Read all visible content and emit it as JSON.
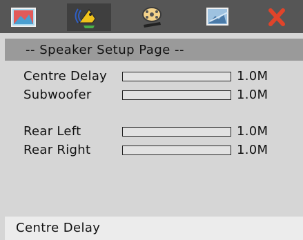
{
  "menu": {
    "tabs": [
      {
        "icon": "picture-icon",
        "active": false
      },
      {
        "icon": "speaker-icon",
        "active": true
      },
      {
        "icon": "film-reel-icon",
        "active": false
      },
      {
        "icon": "image-icon",
        "active": false
      },
      {
        "icon": "close-x-icon",
        "active": false
      }
    ]
  },
  "header": {
    "title": "-- Speaker Setup Page --"
  },
  "rows": [
    {
      "label": "Centre Delay",
      "value": "1.0M"
    },
    {
      "label": "Subwoofer",
      "value": "1.0M"
    },
    {
      "label": "Rear Left",
      "value": "1.0M"
    },
    {
      "label": "Rear Right",
      "value": "1.0M"
    }
  ],
  "footer": {
    "status": "Centre Delay"
  },
  "colors": {
    "topbar": "#565656",
    "active_tab": "#3f3f3f",
    "header_band": "#9a9a9a",
    "panel": "#d6d6d6",
    "footer": "#ececec",
    "close_icon": "#e0442a"
  }
}
